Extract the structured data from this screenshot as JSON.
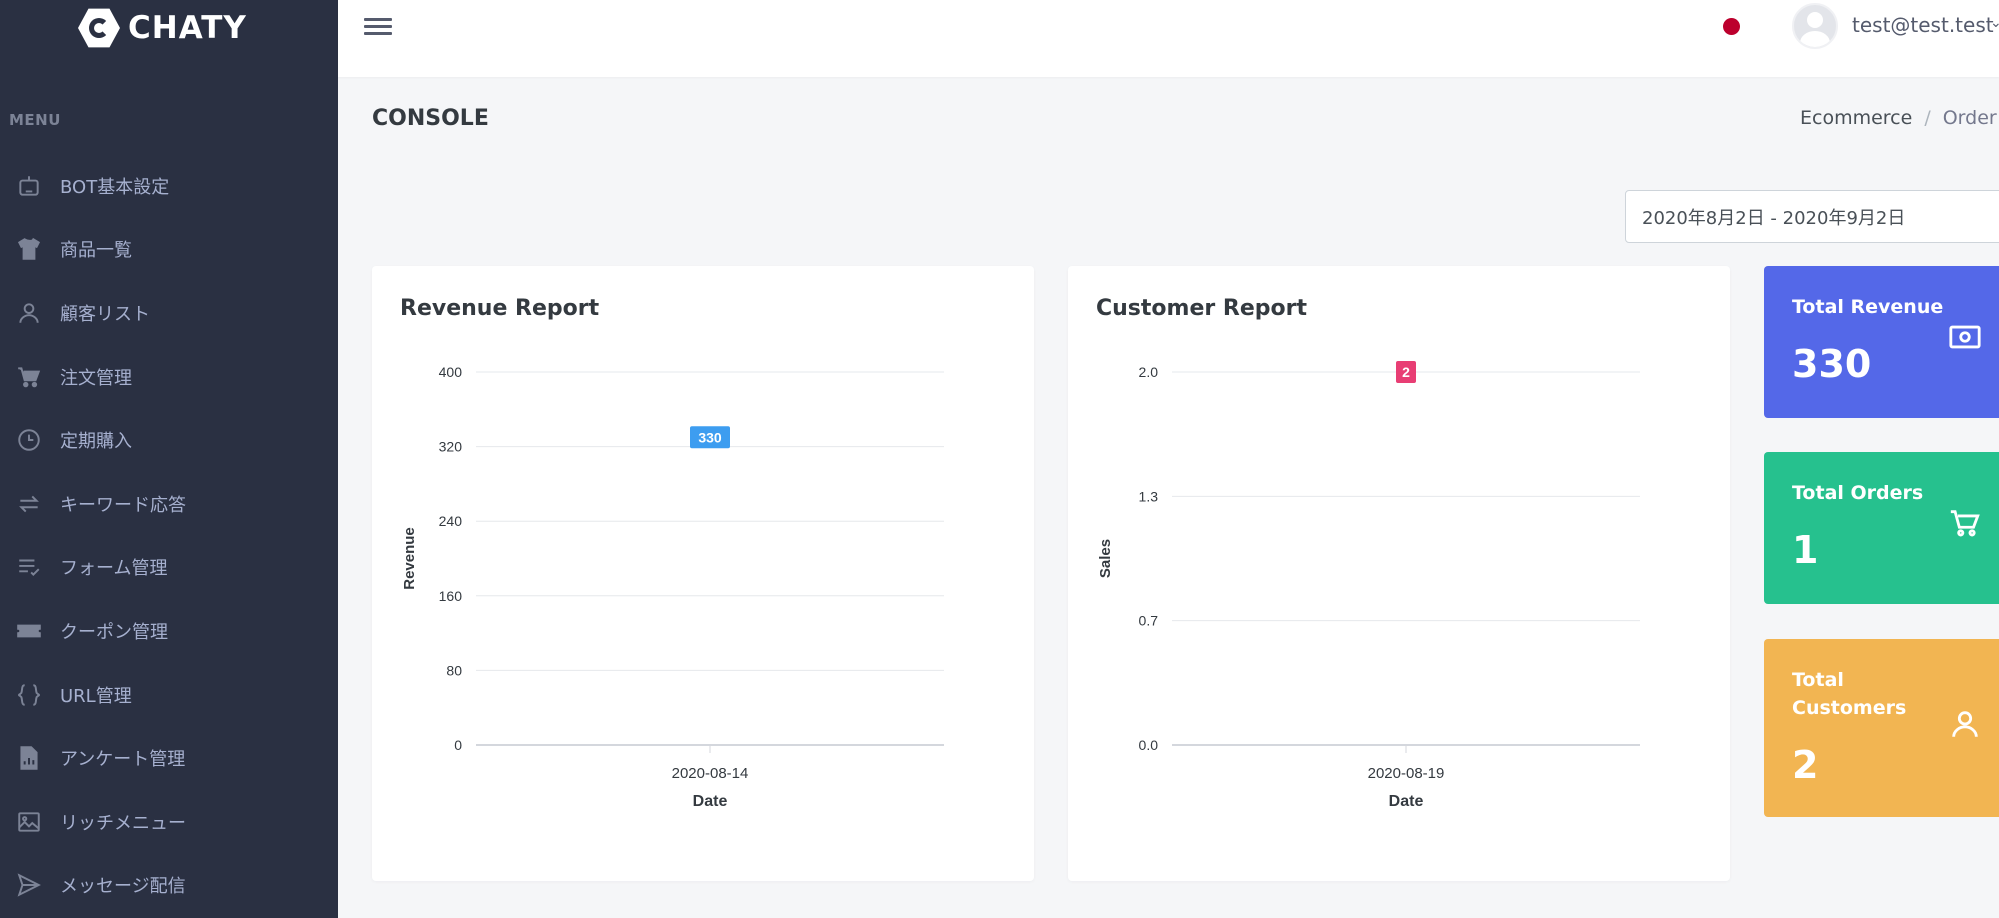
{
  "brand": {
    "name": "CHATY"
  },
  "sidebar": {
    "menu_title": "MENU",
    "items": [
      {
        "label": "BOT基本設定",
        "icon": "robot-icon"
      },
      {
        "label": "商品一覧",
        "icon": "tshirt-icon"
      },
      {
        "label": "顧客リスト",
        "icon": "user-icon"
      },
      {
        "label": "注文管理",
        "icon": "cart-icon"
      },
      {
        "label": "定期購入",
        "icon": "clock-icon"
      },
      {
        "label": "キーワード応答",
        "icon": "swap-arrows-icon"
      },
      {
        "label": "フォーム管理",
        "icon": "list-check-icon"
      },
      {
        "label": "クーポン管理",
        "icon": "ticket-icon"
      },
      {
        "label": "URL管理",
        "icon": "braces-icon"
      },
      {
        "label": "アンケート管理",
        "icon": "report-file-icon"
      },
      {
        "label": "リッチメニュー",
        "icon": "image-icon"
      },
      {
        "label": "メッセージ配信",
        "icon": "send-icon"
      }
    ]
  },
  "topbar": {
    "user_email": "test@test.test",
    "language_flag_color": "#bc002d"
  },
  "page": {
    "title": "CONSOLE",
    "breadcrumb": [
      "Ecommerce",
      "Order"
    ],
    "date_range": "2020年8月2日 - 2020年9月2日"
  },
  "revenue_report": {
    "title": "Revenue Report",
    "chart_data": {
      "type": "bar",
      "categories": [
        "2020-08-14"
      ],
      "values": [
        330
      ],
      "ylim": [
        0,
        400
      ],
      "yticks": [
        "400",
        "320",
        "240",
        "160",
        "80",
        "0"
      ],
      "xlabel": "Date",
      "ylabel": "Revenue",
      "data_labels": [
        "330"
      ],
      "label_color": "#3d9df0",
      "grid": true
    }
  },
  "customer_report": {
    "title": "Customer Report",
    "chart_data": {
      "type": "bar",
      "categories": [
        "2020-08-19"
      ],
      "values": [
        2
      ],
      "ylim": [
        0,
        2
      ],
      "yticks": [
        "2.0",
        "1.3",
        "0.7",
        "0.0"
      ],
      "xlabel": "Date",
      "ylabel": "Sales",
      "data_labels": [
        "2"
      ],
      "label_color": "#e83e74",
      "grid": true
    }
  },
  "stats": [
    {
      "label": "Total Revenue",
      "value": "330",
      "icon": "money-icon",
      "color": "#5468e8"
    },
    {
      "label": "Total Orders",
      "value": "1",
      "icon": "cart-icon",
      "color": "#26c18e"
    },
    {
      "label": "Total Customers",
      "value": "2",
      "icon": "user-icon",
      "color": "#f2b552"
    }
  ]
}
